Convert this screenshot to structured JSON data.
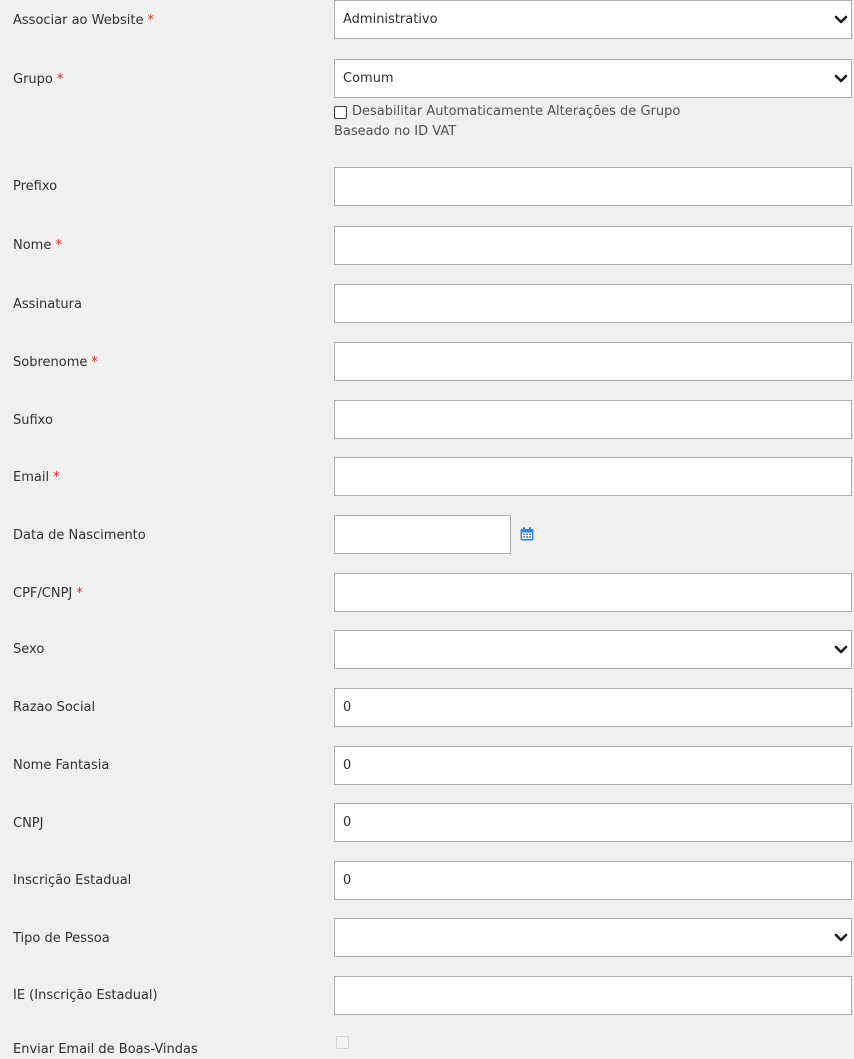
{
  "required_marker": "*",
  "colors": {
    "background": "#f0f0f0",
    "required": "#e22626",
    "input_border": "#adadad",
    "calendar_icon": "#3b82d6"
  },
  "form": {
    "website": {
      "label": "Associar ao Website",
      "value": "Administrativo"
    },
    "group": {
      "label": "Grupo",
      "value": "Comum"
    },
    "disable_group_change": {
      "line1": "Desabilitar Automaticamente Alterações de Grupo",
      "line2": "Baseado no ID VAT",
      "checked": false
    },
    "prefix": {
      "label": "Prefixo",
      "value": ""
    },
    "firstname": {
      "label": "Nome",
      "value": ""
    },
    "signature": {
      "label": "Assinatura",
      "value": ""
    },
    "lastname": {
      "label": "Sobrenome",
      "value": ""
    },
    "suffix": {
      "label": "Sufixo",
      "value": ""
    },
    "email": {
      "label": "Email",
      "value": ""
    },
    "dob": {
      "label": "Data de Nascimento",
      "value": ""
    },
    "taxvat": {
      "label": "CPF/CNPJ",
      "value": ""
    },
    "gender": {
      "label": "Sexo",
      "value": ""
    },
    "razao_social": {
      "label": "Razao Social",
      "value": "0"
    },
    "nome_fantasia": {
      "label": "Nome Fantasia",
      "value": "0"
    },
    "cnpj": {
      "label": "CNPJ",
      "value": "0"
    },
    "inscricao_estadual": {
      "label": "Inscrição Estadual",
      "value": "0"
    },
    "tipo_pessoa": {
      "label": "Tipo de Pessoa",
      "value": ""
    },
    "ie": {
      "label": "IE (Inscrição Estadual)",
      "value": ""
    },
    "welcome_email": {
      "label": "Enviar Email de Boas-Vindas",
      "checked": false
    }
  }
}
